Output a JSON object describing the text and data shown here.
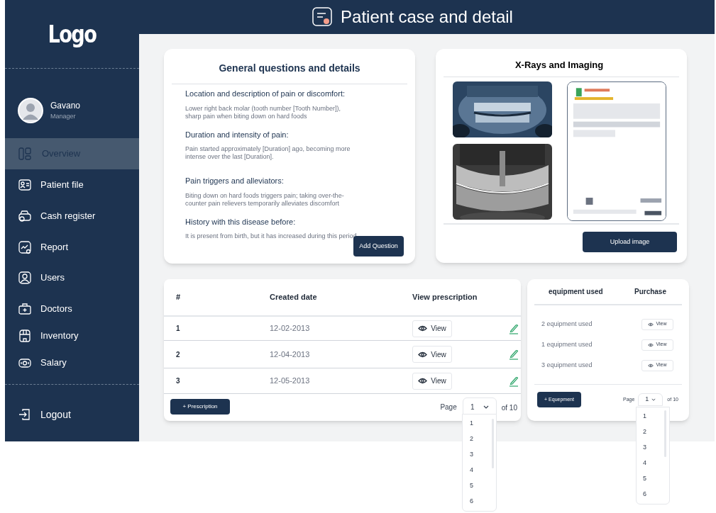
{
  "header": {
    "title": "Patient case and detail"
  },
  "sidebar": {
    "logo": "Logo",
    "user": {
      "name": "Gavano",
      "role": "Manager"
    },
    "items": [
      {
        "label": "Overview",
        "selected": true
      },
      {
        "label": "Patient file",
        "selected": false
      },
      {
        "label": "Cash register",
        "selected": false
      },
      {
        "label": "Report",
        "selected": false
      },
      {
        "label": "Users",
        "selected": false
      },
      {
        "label": "Doctors",
        "selected": false
      },
      {
        "label": "Inventory",
        "selected": false
      },
      {
        "label": "Salary",
        "selected": false
      }
    ],
    "logout": "Logout"
  },
  "questions_card": {
    "title": "General questions and details",
    "items": [
      {
        "question": "Location and description of pain or discomfort:",
        "answer": "Lower right back molar (tooth number [Tooth Number]), sharp pain when biting down on hard foods"
      },
      {
        "question": "Duration and intensity of pain:",
        "answer": "Pain started approximately [Duration] ago, becoming more intense over the last [Duration]."
      },
      {
        "question": "Pain triggers and alleviators:",
        "answer": "Biting down on hard foods triggers pain; taking over-the-counter pain relievers temporarily alleviates discomfort"
      },
      {
        "question": "History with this disease before:",
        "answer": "It is present from birth, but it has increased during this period"
      }
    ],
    "button": "Add Question"
  },
  "imaging_card": {
    "title": "X-Rays and Imaging",
    "button": "Upload image"
  },
  "prescriptions": {
    "columns": [
      "#",
      "Created date",
      "View prescription"
    ],
    "rows": [
      {
        "number": "1",
        "date": "12-02-2013",
        "action": "View"
      },
      {
        "number": "2",
        "date": "12-04-2013",
        "action": "View"
      },
      {
        "number": "3",
        "date": "12-05-2013",
        "action": "View"
      }
    ],
    "add_button": "+ Prescription",
    "pagination": {
      "label": "Page",
      "current": "1",
      "total": "of 10",
      "options": [
        "1",
        "2",
        "3",
        "4",
        "5",
        "6"
      ]
    }
  },
  "equipment": {
    "columns": [
      "equipment used",
      "Purchase"
    ],
    "rows": [
      {
        "name": "2 equipment used",
        "action": "View"
      },
      {
        "name": "1 equipment used",
        "action": "View"
      },
      {
        "name": "3 equipment used",
        "action": "View"
      }
    ],
    "add_button": "+ Equepment",
    "pagination": {
      "label": "Page",
      "current": "1",
      "total": "of 10",
      "options": [
        "1",
        "2",
        "3",
        "4",
        "5",
        "6"
      ]
    }
  }
}
